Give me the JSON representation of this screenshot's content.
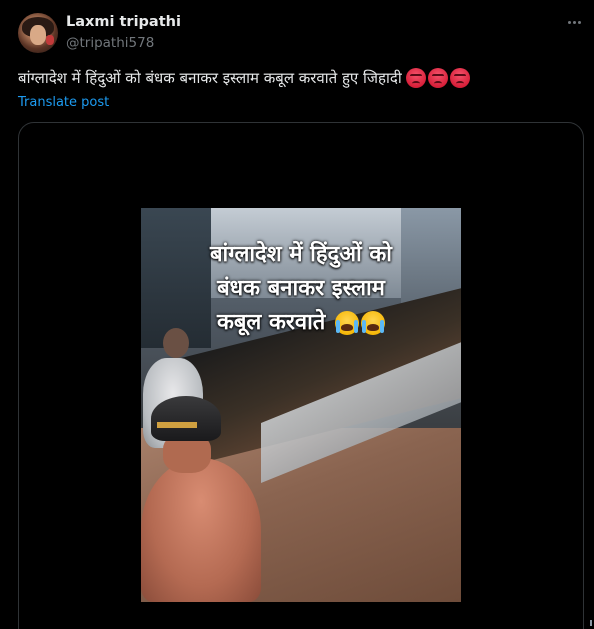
{
  "author": {
    "display_name": "Laxmi tripathi",
    "handle": "@tripathi578"
  },
  "post": {
    "text": "बांग्लादेश में हिंदुओं को बंधक बनाकर इस्लाम कबूल करवाते हुए जिहादी",
    "emojis": [
      "angry-face",
      "angry-face",
      "angry-face"
    ],
    "translate_label": "Translate post"
  },
  "media": {
    "overlay_lines": [
      "बांग्लादेश में हिंदुओं को",
      "बंधक बनाकर इस्लाम",
      "कबूल करवाते"
    ],
    "overlay_emojis": [
      "loudly-crying-face",
      "loudly-crying-face"
    ]
  },
  "colors": {
    "background": "#000000",
    "text_primary": "#e7e9ea",
    "text_secondary": "#71767b",
    "link": "#1d9bf0",
    "border": "#2f3336"
  }
}
